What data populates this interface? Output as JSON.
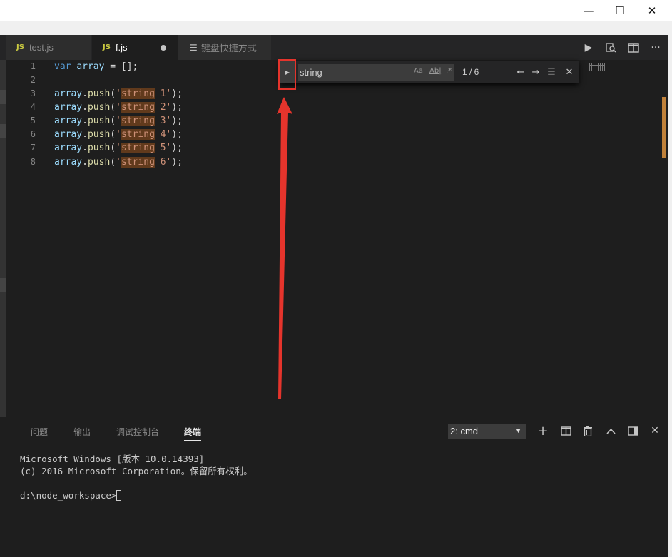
{
  "window": {
    "minimize_glyph": "—",
    "maximize_glyph": "☐",
    "close_glyph": "✕"
  },
  "tabs": [
    {
      "badge": "JS",
      "label": "test.js"
    },
    {
      "badge": "JS",
      "label": "f.js"
    },
    {
      "label": "键盘快捷方式"
    }
  ],
  "editor": {
    "lines": [
      {
        "n": "1",
        "tokens": [
          [
            "kw",
            "var"
          ],
          [
            "plain",
            " "
          ],
          [
            "var",
            "array"
          ],
          [
            "plain",
            " = [];"
          ]
        ]
      },
      {
        "n": "2",
        "tokens": []
      },
      {
        "n": "3",
        "tokens": [
          [
            "var",
            "array"
          ],
          [
            "plain",
            "."
          ],
          [
            "fn",
            "push"
          ],
          [
            "plain",
            "("
          ],
          [
            "str",
            "'"
          ],
          [
            "match",
            "string"
          ],
          [
            "str",
            " 1'"
          ],
          [
            "plain",
            ");"
          ]
        ]
      },
      {
        "n": "4",
        "tokens": [
          [
            "var",
            "array"
          ],
          [
            "plain",
            "."
          ],
          [
            "fn",
            "push"
          ],
          [
            "plain",
            "("
          ],
          [
            "str",
            "'"
          ],
          [
            "match",
            "string"
          ],
          [
            "str",
            " 2'"
          ],
          [
            "plain",
            ");"
          ]
        ]
      },
      {
        "n": "5",
        "tokens": [
          [
            "var",
            "array"
          ],
          [
            "plain",
            "."
          ],
          [
            "fn",
            "push"
          ],
          [
            "plain",
            "("
          ],
          [
            "str",
            "'"
          ],
          [
            "match",
            "string"
          ],
          [
            "str",
            " 3'"
          ],
          [
            "plain",
            ");"
          ]
        ]
      },
      {
        "n": "6",
        "tokens": [
          [
            "var",
            "array"
          ],
          [
            "plain",
            "."
          ],
          [
            "fn",
            "push"
          ],
          [
            "plain",
            "("
          ],
          [
            "str",
            "'"
          ],
          [
            "match",
            "string"
          ],
          [
            "str",
            " 4'"
          ],
          [
            "plain",
            ");"
          ]
        ]
      },
      {
        "n": "7",
        "tokens": [
          [
            "var",
            "array"
          ],
          [
            "plain",
            "."
          ],
          [
            "fn",
            "push"
          ],
          [
            "plain",
            "("
          ],
          [
            "str",
            "'"
          ],
          [
            "match",
            "string"
          ],
          [
            "str",
            " 5'"
          ],
          [
            "plain",
            ");"
          ]
        ]
      },
      {
        "n": "8",
        "tokens": [
          [
            "var",
            "array"
          ],
          [
            "plain",
            "."
          ],
          [
            "fn",
            "push"
          ],
          [
            "plain",
            "("
          ],
          [
            "str",
            "'"
          ],
          [
            "match",
            "string"
          ],
          [
            "str",
            " 6'"
          ],
          [
            "plain",
            ");"
          ]
        ]
      }
    ]
  },
  "find": {
    "query": "string",
    "match_case": "Aa",
    "whole_word": "Ab|",
    "regex": ".*",
    "count": "1 / 6"
  },
  "panel": {
    "tabs": [
      "问题",
      "输出",
      "调试控制台",
      "终端"
    ],
    "active_tab": "终端",
    "terminal_select": "2: cmd",
    "terminal_lines": [
      "Microsoft Windows [版本 10.0.14393]",
      "(c) 2016 Microsoft Corporation。保留所有权利。",
      "",
      "d:\\node_workspace>"
    ]
  },
  "colors": {
    "accent_red": "#e5342c",
    "match_bg": "#613a1c",
    "js_badge": "#cbcb41"
  },
  "icons": [
    "play-icon",
    "open-changes-icon",
    "split-editor-icon",
    "more-icon",
    "add-terminal-icon",
    "split-terminal-icon",
    "trash-icon",
    "chevron-up-icon",
    "maximize-panel-icon",
    "close-panel-icon"
  ]
}
